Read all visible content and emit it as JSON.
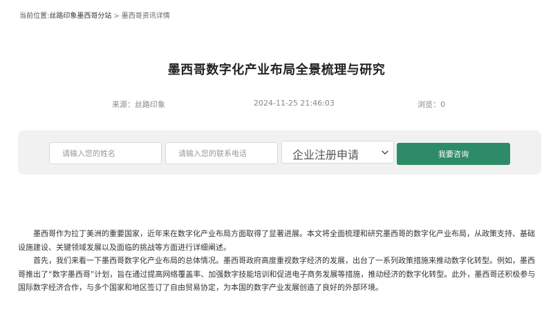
{
  "breadcrumb": {
    "prefix": "当前位置:",
    "link": "丝路印象墨西哥分站",
    "separator": ">",
    "current": "墨西哥资讯详情"
  },
  "article": {
    "title": "墨西哥数字化产业布局全景梳理与研究",
    "source": "来源：丝路印象",
    "date": "2024-11-25 21:46:03",
    "views": "浏览：0",
    "paragraphs": [
      "墨西哥作为拉丁美洲的重要国家，近年来在数字化产业布局方面取得了显著进展。本文将全面梳理和研究墨西哥的数字化产业布局，从政策支持、基础设施建设、关键领域发展以及面临的挑战等方面进行详细阐述。",
      "首先，我们来看一下墨西哥数字化产业布局的总体情况。墨西哥政府高度重视数字经济的发展，出台了一系列政策措施来推动数字化转型。例如，墨西哥推出了“数字墨西哥”计划，旨在通过提高网络覆盖率、加强数字技能培训和促进电子商务发展等措施，推动经济的数字化转型。此外，墨西哥还积极参与国际数字经济合作，与多个国家和地区签订了自由贸易协定，为本国的数字产业发展创造了良好的外部环境。"
    ]
  },
  "form": {
    "name_placeholder": "请输入您的姓名",
    "phone_placeholder": "请输入您的联系电话",
    "service_selected": "企业注册申请",
    "submit_label": "我要咨询",
    "accent_color": "#2e8b68"
  }
}
